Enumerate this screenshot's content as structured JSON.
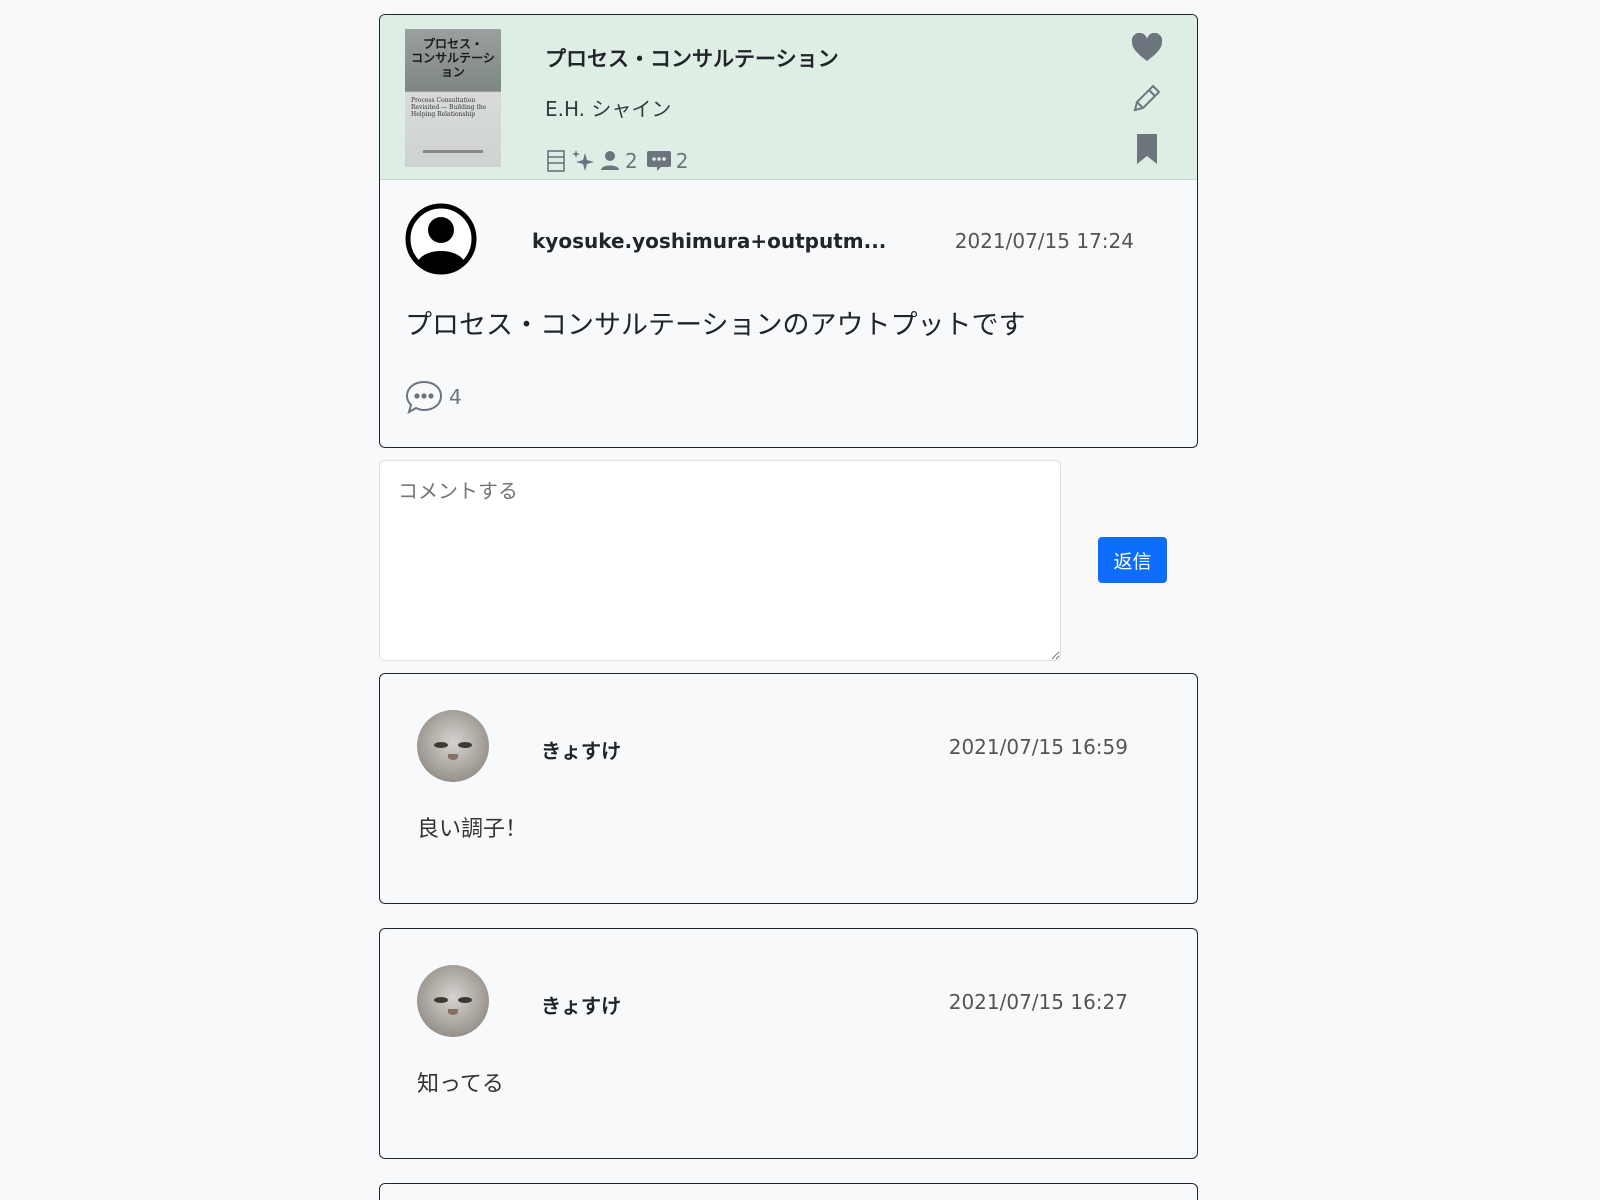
{
  "book": {
    "cover": {
      "title_line1": "プロセス・",
      "title_line2": "コンサルテーション",
      "subtitle": "Process Consultation Revisited — Building the Helping Relationship"
    },
    "title": "プロセス・コンサルテーション",
    "author": "E.H. シャイン",
    "stats": {
      "users": "2",
      "comments": "2"
    },
    "icons": [
      "list-icon",
      "sparkles-icon",
      "person-icon",
      "chat-dots-icon",
      "heart-icon",
      "pencil-icon",
      "bookmark-icon"
    ]
  },
  "post": {
    "user_name": "kyosuke.yoshimura+outputm...",
    "date": "2021/07/15 17:24",
    "body": "プロセス・コンサルテーションのアウトプットです",
    "comment_count": "4"
  },
  "comment_form": {
    "placeholder": "コメントする",
    "submit_label": "返信",
    "submit_color": "#0d6efd"
  },
  "comments": [
    {
      "user_name": "きょすけ",
      "date": "2021/07/15 16:59",
      "text": "良い調子！"
    },
    {
      "user_name": "きょすけ",
      "date": "2021/07/15 16:27",
      "text": "知ってる"
    }
  ],
  "colors": {
    "header_bg": "#dfeee5",
    "page_bg": "#f8f9fa",
    "muted": "#6c757d"
  }
}
